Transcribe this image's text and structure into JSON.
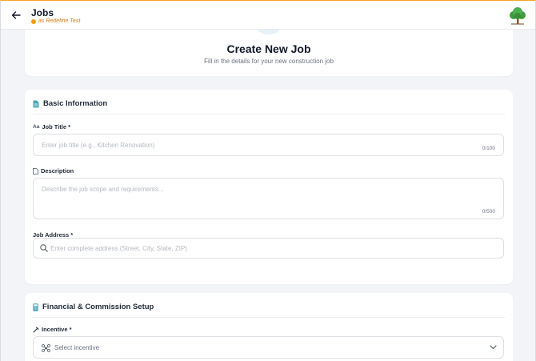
{
  "header": {
    "title": "Jobs",
    "subtitle": "as Redefine Test"
  },
  "hero": {
    "title": "Create New Job",
    "subtitle": "Fill in the details for your new construction job"
  },
  "basic_info": {
    "heading": "Basic Information",
    "job_title": {
      "label": "Job Title *",
      "prefix": "Aa",
      "placeholder": "Enter job title (e.g., Kitchen Renovation)",
      "counter": "0/100"
    },
    "description": {
      "label": "Description",
      "placeholder": "Describe the job scope and requirements...",
      "counter": "0/500"
    },
    "job_address": {
      "label": "Job Address *",
      "placeholder": "Enter complete address (Street, City, State, ZIP)"
    }
  },
  "financial": {
    "heading": "Financial & Commission Setup",
    "incentive": {
      "label": "Incentive *",
      "selected": "Select incentive"
    }
  },
  "colors": {
    "accent": "#f5a623",
    "section_icon": "#4aa7b8",
    "page_bg": "#f3f4f7"
  },
  "icons": {
    "back": "arrow-left-icon",
    "logo": "tree-logo-icon",
    "basic": "document-icon",
    "description": "file-icon",
    "address": "search-icon",
    "finance": "calculator-icon",
    "incentive": "hammer-icon",
    "incentive_select": "drone-icon",
    "dropdown": "chevron-down-icon"
  }
}
